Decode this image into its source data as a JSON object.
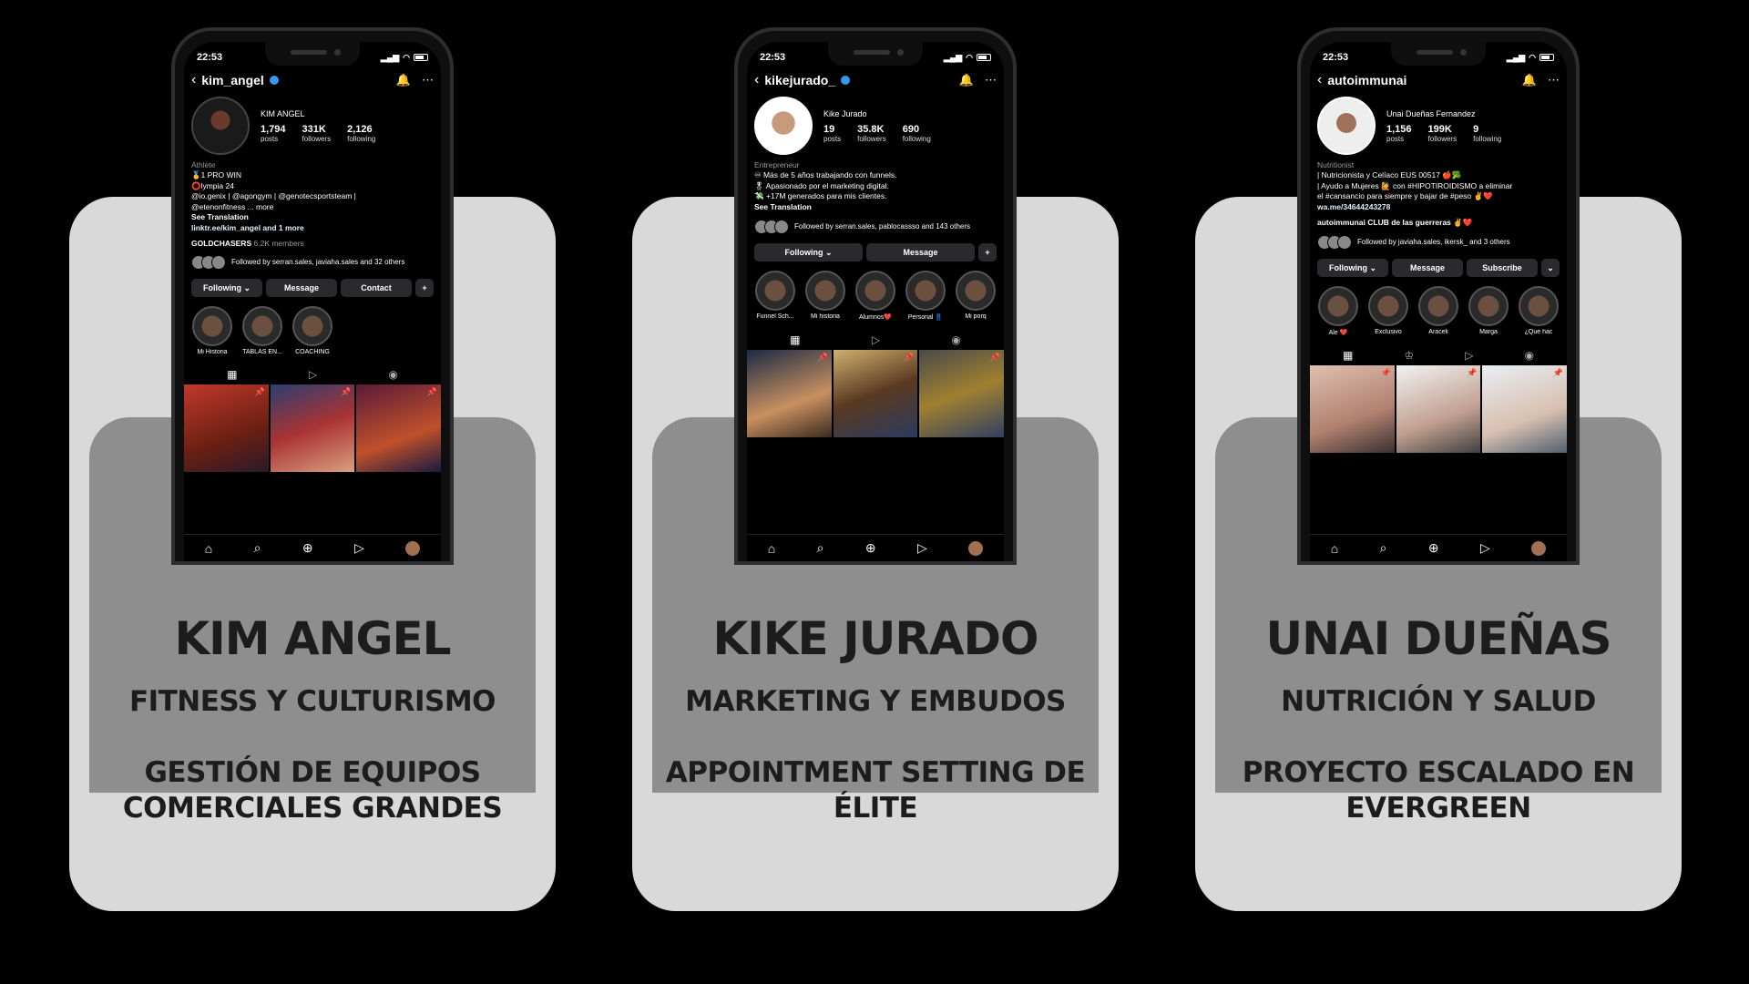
{
  "cards": [
    {
      "name": "KIM ANGEL",
      "niche": "FITNESS Y CULTURISMO",
      "service": "GESTIÓN DE EQUIPOS COMERCIALES GRANDES",
      "phone": {
        "time": "22:53",
        "handle": "kim_angel",
        "display_name": "KIM ANGEL",
        "stats": [
          {
            "value": "1,794",
            "label": "posts"
          },
          {
            "value": "331K",
            "label": "followers"
          },
          {
            "value": "2,126",
            "label": "following"
          }
        ],
        "bio_category": "Athlete",
        "bio_lines": [
          "🥇1 PRO WIN",
          "⭕lympia 24",
          "@io.genix | @agongym | @genotecsportsteam |",
          "@etenonfitness ... more"
        ],
        "see_translation": "See Translation",
        "link": "linktr.ee/kim_angel and 1 more",
        "community": "GOLDCHASERS",
        "community_count": "6.2K members",
        "followed_by": "Followed by serran.sales, javiaha.sales and 32 others",
        "buttons": [
          "Following ⌄",
          "Message",
          "Contact"
        ],
        "highlights": [
          "Mi Historia",
          "TABLAS EN...",
          "COACHING"
        ]
      }
    },
    {
      "name": "KIKE JURADO",
      "niche": "MARKETING Y EMBUDOS",
      "service": "APPOINTMENT SETTING DE ÉLITE",
      "phone": {
        "time": "22:53",
        "handle": "kikejurado_",
        "display_name": "Kike Jurado",
        "stats": [
          {
            "value": "19",
            "label": "posts"
          },
          {
            "value": "35.8K",
            "label": "followers"
          },
          {
            "value": "690",
            "label": "following"
          }
        ],
        "bio_category": "Entrepreneur",
        "bio_lines": [
          "♾ Más de 5 años trabajando con funnels.",
          "🎖 Apasionado por el marketing digital.",
          "💸 +17M generados para mis clientes."
        ],
        "see_translation": "See Translation",
        "link": "",
        "community": "",
        "community_count": "",
        "followed_by": "Followed by serran.sales, pablocassso and 143 others",
        "buttons": [
          "Following ⌄",
          "Message"
        ],
        "highlights": [
          "Funnel Sch...",
          "Mi historia",
          "Alumnos❤️",
          "Personal 👖",
          "Mi porq"
        ]
      }
    },
    {
      "name": "UNAI DUEÑAS",
      "niche": "NUTRICIÓN Y SALUD",
      "service": "PROYECTO ESCALADO EN EVERGREEN",
      "phone": {
        "time": "22:53",
        "handle": "autoimmunai",
        "display_name": "Unai Dueñas Fernandez",
        "stats": [
          {
            "value": "1,156",
            "label": "posts"
          },
          {
            "value": "199K",
            "label": "followers"
          },
          {
            "value": "9",
            "label": "following"
          }
        ],
        "bio_category": "Nutritionist",
        "bio_lines": [
          "| Nutricionista y Celíaco EUS 00517 🍎🥦",
          "| Ayudo a Mujeres 🙋 con #HIPOTIROIDISMO a eliminar",
          "el #cansancio para siempre y bajar de #peso ✌️❤️"
        ],
        "see_translation": "",
        "link": "wa.me/34644243278",
        "community": "autoimmunai  CLUB de las guerreras ✌️❤️",
        "community_count": "",
        "followed_by": "Followed by javiaha.sales, ikersk_ and 3 others",
        "buttons": [
          "Following ⌄",
          "Message",
          "Subscribe"
        ],
        "highlights": [
          "Ale ❤️",
          "Exclusivo",
          "Araceli",
          "Marga",
          "¿Que hac"
        ]
      }
    }
  ]
}
